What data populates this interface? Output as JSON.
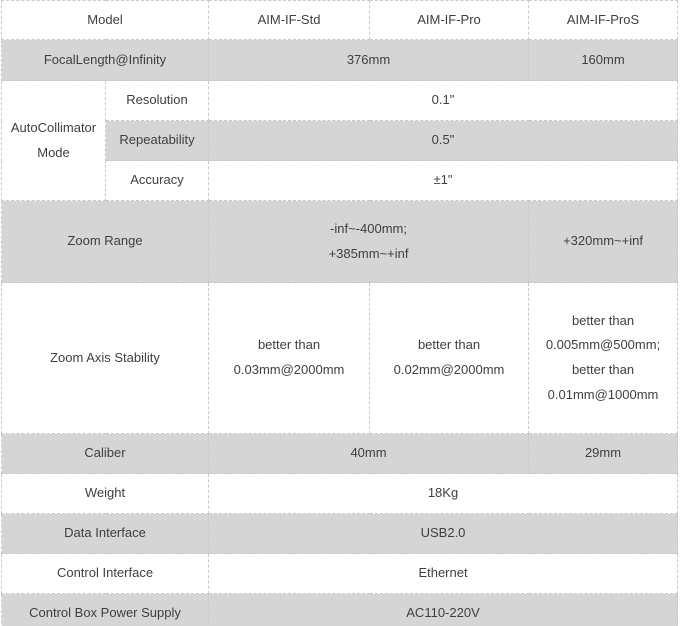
{
  "table": {
    "columns": {
      "label": "Model",
      "models": [
        "AIM-IF-Std",
        "AIM-IF-Pro",
        "AIM-IF-ProS"
      ]
    },
    "rows": {
      "focal_length": {
        "label": "FocalLength@Infinity",
        "std_pro": "376mm",
        "pros": "160mm"
      },
      "autocollimator": {
        "label_line1": "AutoCollimator",
        "label_line2": "Mode",
        "sub_rows": [
          {
            "label": "Resolution",
            "value": "0.1\""
          },
          {
            "label": "Repeatability",
            "value": "0.5\""
          },
          {
            "label": "Accuracy",
            "value": "±1\""
          }
        ]
      },
      "zoom_range": {
        "label": "Zoom Range",
        "std_pro_line1": "-inf~-400mm;",
        "std_pro_line2": "+385mm~+inf",
        "pros": "+320mm~+inf"
      },
      "zoom_axis_stability": {
        "label": "Zoom Axis Stability",
        "std_line1": "better than",
        "std_line2": "0.03mm@2000mm",
        "pro_line1": "better than",
        "pro_line2": "0.02mm@2000mm",
        "pros_line1": "better than",
        "pros_line2": "0.005mm@500mm;",
        "pros_line3": "better than",
        "pros_line4": "0.01mm@1000mm"
      },
      "caliber": {
        "label": "Caliber",
        "std_pro": "40mm",
        "pros": "29mm"
      },
      "weight": {
        "label": "Weight",
        "value": "18Kg"
      },
      "data_interface": {
        "label": "Data Interface",
        "value": "USB2.0"
      },
      "control_interface": {
        "label": "Control Interface",
        "value": "Ethernet"
      },
      "power_supply": {
        "label": "Control Box Power Supply",
        "value": "AC110-220V"
      }
    }
  },
  "colors": {
    "band_gray": "#d5d5d5",
    "background": "#ffffff",
    "text": "#3f3f3f",
    "border": "#c9c9c9"
  }
}
